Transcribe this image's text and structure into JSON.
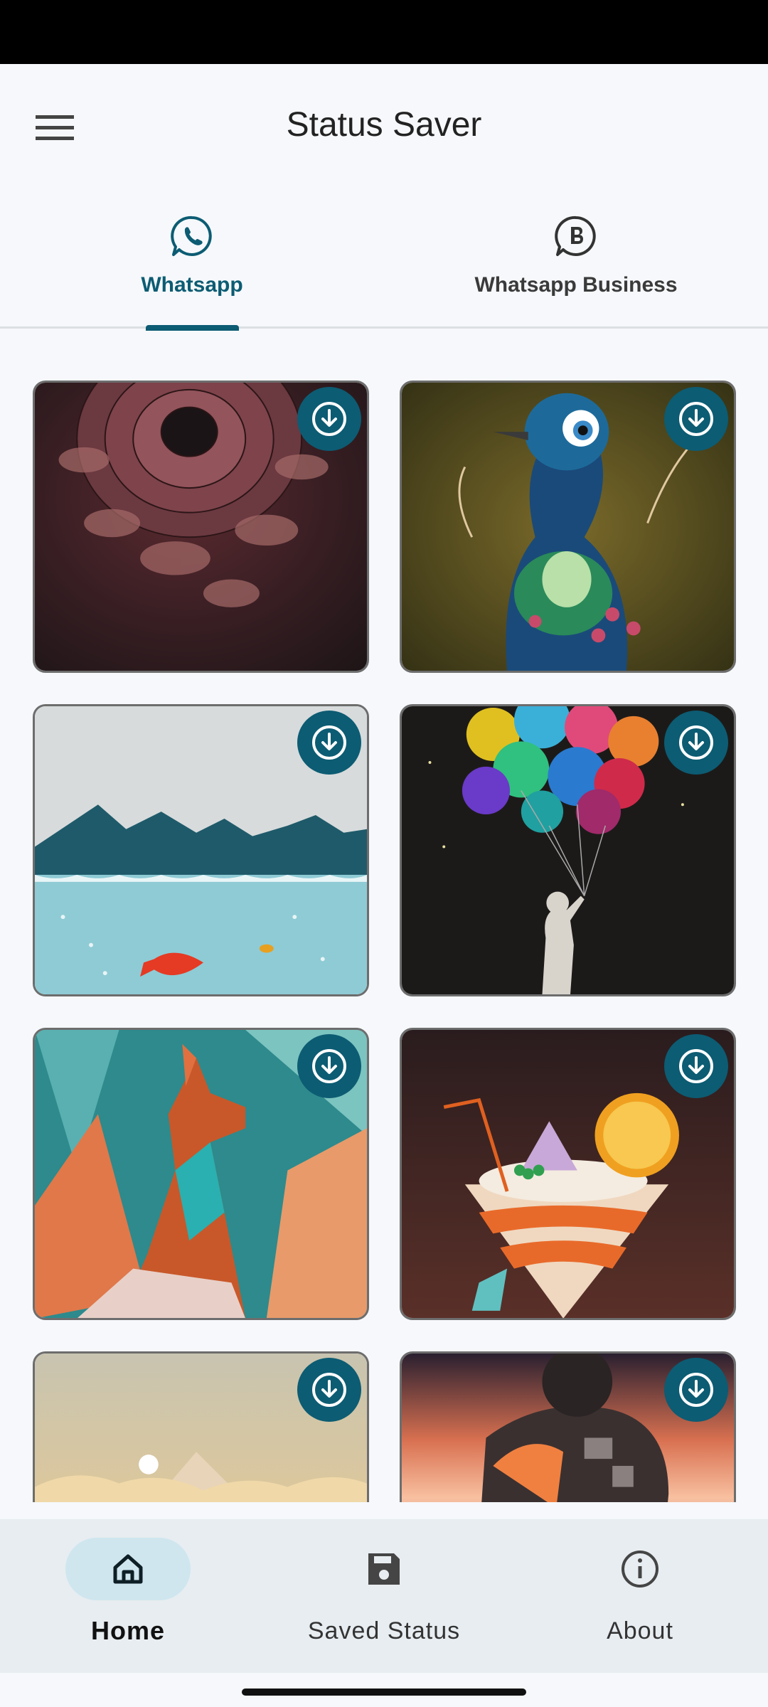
{
  "app": {
    "title": "Status Saver"
  },
  "tabs": [
    {
      "label": "Whatsapp",
      "icon": "whatsapp-icon",
      "active": true
    },
    {
      "label": "Whatsapp Business",
      "icon": "whatsapp-business-icon",
      "active": false
    }
  ],
  "grid": {
    "items": [
      {
        "image": "dahlia-flower",
        "action_icon": "download-icon"
      },
      {
        "image": "peacock-bird",
        "action_icon": "download-icon"
      },
      {
        "image": "mountain-lake-fish",
        "action_icon": "download-icon"
      },
      {
        "image": "child-with-balloons",
        "action_icon": "download-icon"
      },
      {
        "image": "low-poly-fox",
        "action_icon": "download-icon"
      },
      {
        "image": "ice-cream-cocktail",
        "action_icon": "download-icon"
      },
      {
        "image": "desert-pyramid-sky",
        "action_icon": "download-icon"
      },
      {
        "image": "astronaut-sunset",
        "action_icon": "download-icon"
      }
    ]
  },
  "bottom_nav": {
    "items": [
      {
        "label": "Home",
        "icon": "home-icon",
        "active": true
      },
      {
        "label": "Saved Status",
        "icon": "save-icon",
        "active": false
      },
      {
        "label": "About",
        "icon": "info-icon",
        "active": false
      }
    ]
  },
  "colors": {
    "accent": "#0c5c73",
    "background": "#f6f8fb",
    "nav_background": "#e7edf1",
    "active_pill": "#cfe6ef"
  }
}
